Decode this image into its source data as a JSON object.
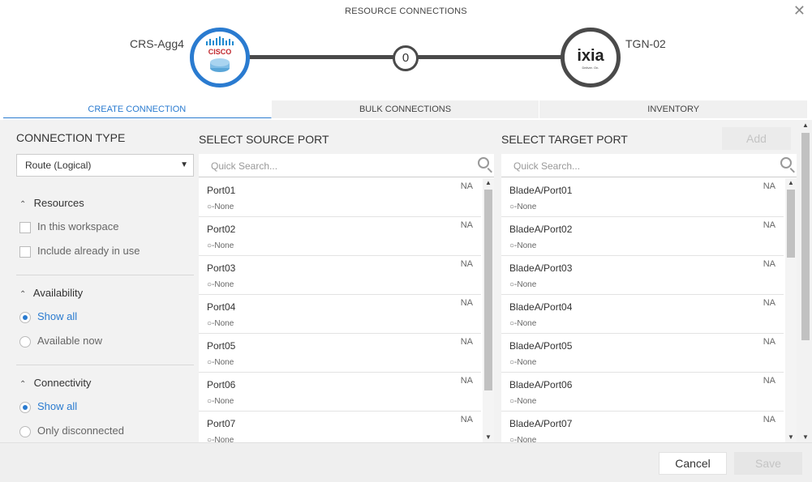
{
  "dialog": {
    "title": "RESOURCE CONNECTIONS"
  },
  "source_device": {
    "name": "CRS-Agg4",
    "logo_text": "CISCO"
  },
  "target_device": {
    "name": "TGN-02",
    "logo_text": "ixia",
    "logo_tagline": "Deliver. On."
  },
  "connection_count": "0",
  "tabs": [
    {
      "label": "CREATE CONNECTION",
      "active": true
    },
    {
      "label": "BULK CONNECTIONS",
      "active": false
    },
    {
      "label": "INVENTORY",
      "active": false
    }
  ],
  "sidebar": {
    "connection_type_label": "CONNECTION TYPE",
    "connection_type_value": "Route (Logical)",
    "resources": {
      "title": "Resources",
      "options": [
        "In this workspace",
        "Include already in use"
      ]
    },
    "availability": {
      "title": "Availability",
      "options": [
        "Show all",
        "Available now"
      ],
      "selected": "Show all"
    },
    "connectivity": {
      "title": "Connectivity",
      "options": [
        "Show all",
        "Only disconnected"
      ],
      "selected": "Show all"
    }
  },
  "source": {
    "title": "SELECT SOURCE PORT",
    "search_placeholder": "Quick Search...",
    "ports": [
      {
        "name": "Port01",
        "status": "NA",
        "connection": "None"
      },
      {
        "name": "Port02",
        "status": "NA",
        "connection": "None"
      },
      {
        "name": "Port03",
        "status": "NA",
        "connection": "None"
      },
      {
        "name": "Port04",
        "status": "NA",
        "connection": "None"
      },
      {
        "name": "Port05",
        "status": "NA",
        "connection": "None"
      },
      {
        "name": "Port06",
        "status": "NA",
        "connection": "None"
      },
      {
        "name": "Port07",
        "status": "NA",
        "connection": "None"
      }
    ]
  },
  "target": {
    "title": "SELECT TARGET PORT",
    "search_placeholder": "Quick Search...",
    "ports": [
      {
        "name": "BladeA/Port01",
        "status": "NA",
        "connection": "None"
      },
      {
        "name": "BladeA/Port02",
        "status": "NA",
        "connection": "None"
      },
      {
        "name": "BladeA/Port03",
        "status": "NA",
        "connection": "None"
      },
      {
        "name": "BladeA/Port04",
        "status": "NA",
        "connection": "None"
      },
      {
        "name": "BladeA/Port05",
        "status": "NA",
        "connection": "None"
      },
      {
        "name": "BladeA/Port06",
        "status": "NA",
        "connection": "None"
      },
      {
        "name": "BladeA/Port07",
        "status": "NA",
        "connection": "None"
      }
    ]
  },
  "buttons": {
    "add": "Add",
    "cancel": "Cancel",
    "save": "Save"
  },
  "colors": {
    "accent": "#2a7bd0",
    "source_ring": "#2a7bd0",
    "target_ring": "#4a4a4a"
  }
}
